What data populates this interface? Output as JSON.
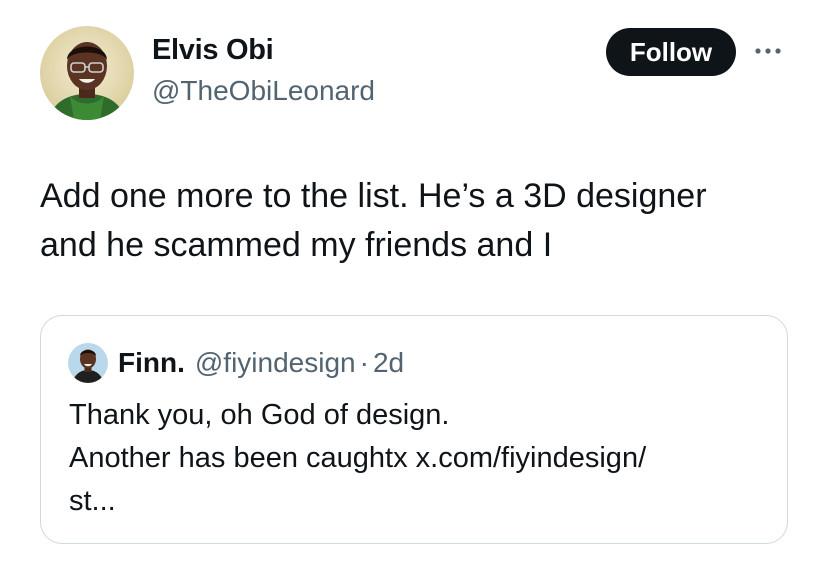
{
  "author": {
    "display_name": "Elvis Obi",
    "handle": "@TheObiLeonard",
    "avatar_icon": "user-avatar-photo"
  },
  "follow_label": "Follow",
  "more_icon": "more-horizontal-icon",
  "tweet_text": "Add one more to the list. He’s a 3D designer\nand he scammed my friends and I",
  "quote": {
    "display_name": "Finn.",
    "handle": "@fiyindesign",
    "separator": "·",
    "time": "2d",
    "text": "Thank you, oh God of design.\nAnother has been caughtx x.com/fiyindesign/\nst..."
  },
  "colors": {
    "text_primary": "#0f1419",
    "text_secondary": "#536471",
    "border": "#cfd9de",
    "follow_bg": "#0f1419"
  }
}
